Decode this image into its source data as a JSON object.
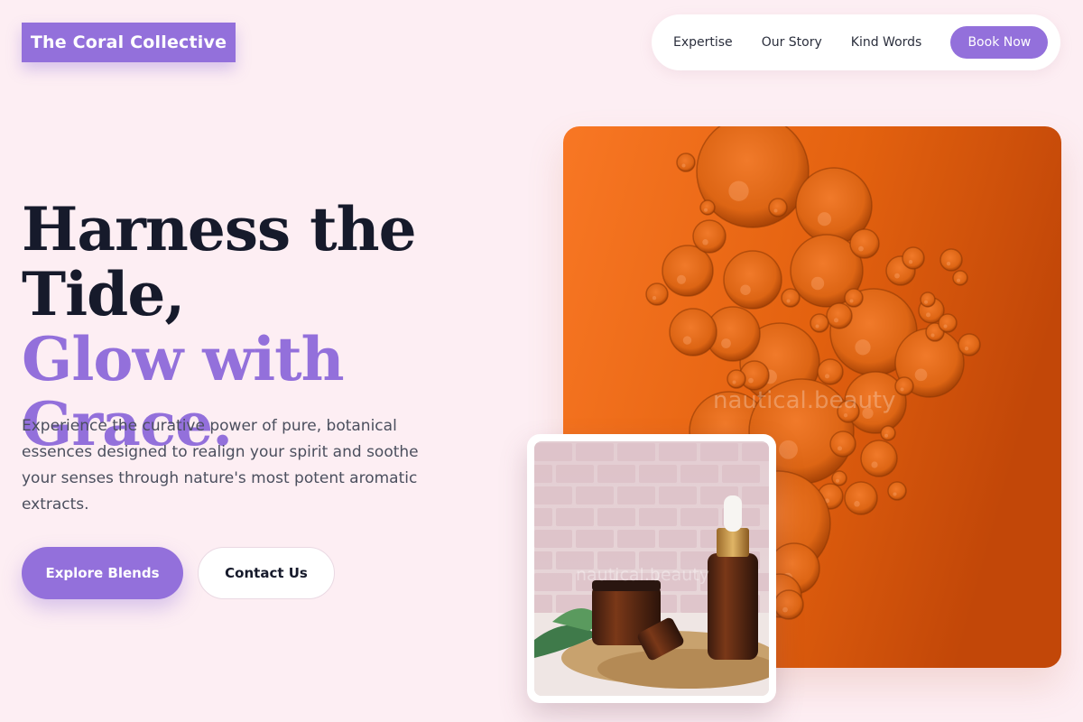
{
  "brand": {
    "name": "The Coral Collective",
    "accent": "#9370db",
    "background": "#fdeef3"
  },
  "nav": {
    "links": [
      "Expertise",
      "Our Story",
      "Kind Words"
    ],
    "cta": "Book Now"
  },
  "hero": {
    "headline_line1": "Harness the",
    "headline_line2": "Tide,",
    "headline_accent": "Glow with Grace.",
    "lead": "Experience the curative power of pure, botanical essences designed to realign your spirit and soothe your senses through nature's most potent aromatic extracts.",
    "primary_button": "Explore Blends",
    "secondary_button": "Contact Us"
  },
  "images": {
    "main": {
      "subject": "orange oil bubbles",
      "watermark": "nautical.beauty"
    },
    "inset": {
      "subject": "amber dropper bottles on burlap",
      "watermark": "nautical.beauty"
    }
  }
}
